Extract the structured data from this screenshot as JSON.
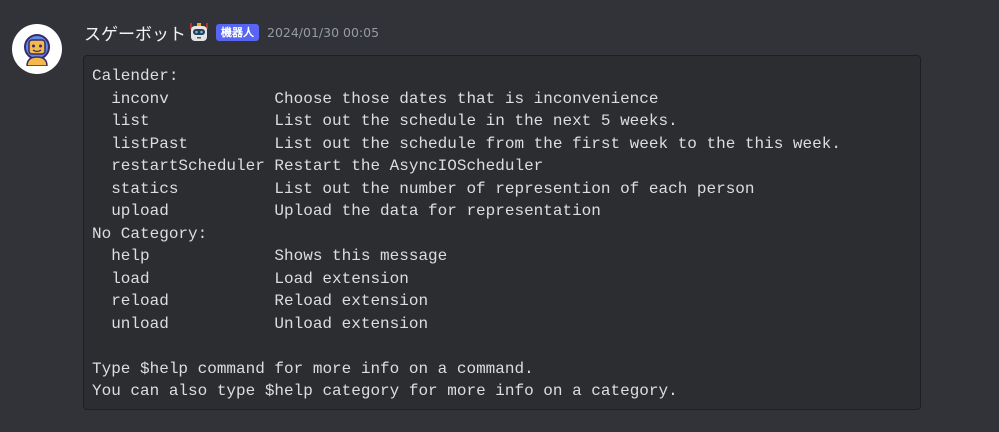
{
  "message": {
    "username": "スゲーボット",
    "bot_badge": "機器人",
    "timestamp": "2024/01/30 00:05",
    "avatar_icon": "robot-astronaut-icon",
    "colors": {
      "badge": "#5865f2",
      "background": "#313338",
      "code_background": "#2b2d31"
    }
  },
  "help": {
    "category1": "Calender:",
    "calendar_commands": [
      {
        "name": "inconv",
        "desc": "Choose those dates that is inconvenience"
      },
      {
        "name": "list",
        "desc": "List out the schedule in the next 5 weeks."
      },
      {
        "name": "listPast",
        "desc": "List out the schedule from the first week to the this week."
      },
      {
        "name": "restartScheduler",
        "desc": "Restart the AsyncIOScheduler"
      },
      {
        "name": "statics",
        "desc": "List out the number of represention of each person"
      },
      {
        "name": "upload",
        "desc": "Upload the data for representation"
      }
    ],
    "category2": "No Category:",
    "other_commands": [
      {
        "name": "help",
        "desc": "Shows this message"
      },
      {
        "name": "load",
        "desc": "Load extension"
      },
      {
        "name": "reload",
        "desc": "Reload extension"
      },
      {
        "name": "unload",
        "desc": "Unload extension"
      }
    ],
    "footer1": "Type $help command for more info on a command.",
    "footer2": "You can also type $help category for more info on a category."
  }
}
